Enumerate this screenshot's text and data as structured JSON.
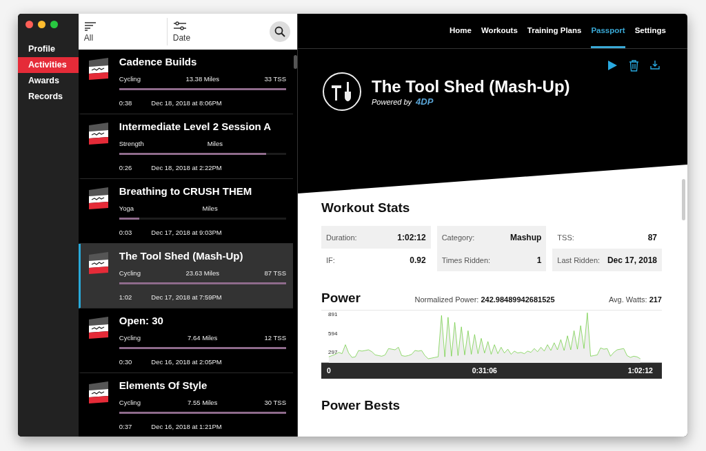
{
  "window": {
    "controls": [
      {
        "color": "#fe5f57"
      },
      {
        "color": "#febc2e"
      },
      {
        "color": "#28c840"
      }
    ]
  },
  "sidebar": {
    "items": [
      {
        "label": "Profile",
        "selected": false
      },
      {
        "label": "Activities",
        "selected": true
      },
      {
        "label": "Awards",
        "selected": false
      },
      {
        "label": "Records",
        "selected": false
      }
    ]
  },
  "toolbar": {
    "filter": "All",
    "sort": "Date"
  },
  "activities": [
    {
      "title": "Cadence Builds",
      "type": "Cycling",
      "distance": "13.38 Miles",
      "tss": "33 TSS",
      "duration": "0:38",
      "date": "Dec 18, 2018 at 8:06PM",
      "level": 1,
      "selected": false
    },
    {
      "title": "Intermediate Level 2 Session A",
      "type": "Strength",
      "distance": "Miles",
      "duration": "0:26",
      "date": "Dec 18, 2018 at 2:22PM",
      "level": 0.88,
      "selected": false
    },
    {
      "title": "Breathing to CRUSH THEM",
      "type": "Yoga",
      "distance": "Miles",
      "duration": "0:03",
      "date": "Dec 17, 2018 at 9:03PM",
      "level": 0.12,
      "selected": false
    },
    {
      "title": "The Tool Shed (Mash-Up)",
      "type": "Cycling",
      "distance": "23.63 Miles",
      "tss": "87 TSS",
      "duration": "1:02",
      "date": "Dec 17, 2018 at 7:59PM",
      "level": 1,
      "selected": true
    },
    {
      "title": "Open: 30",
      "type": "Cycling",
      "distance": "7.64 Miles",
      "tss": "12 TSS",
      "duration": "0:30",
      "date": "Dec 16, 2018 at 2:05PM",
      "level": 1,
      "selected": false
    },
    {
      "title": "Elements Of Style",
      "type": "Cycling",
      "distance": "7.55 Miles",
      "tss": "30 TSS",
      "duration": "0:37",
      "date": "Dec 16, 2018 at 1:21PM",
      "level": 1,
      "selected": false
    }
  ],
  "nav": [
    {
      "label": "Home",
      "selected": false
    },
    {
      "label": "Workouts",
      "selected": false
    },
    {
      "label": "Training Plans",
      "selected": false
    },
    {
      "label": "Passport",
      "selected": true
    },
    {
      "label": "Settings",
      "selected": false
    }
  ],
  "workout": {
    "title": "The Tool Shed (Mash-Up)",
    "powered_by": "Powered by",
    "brand": "4DP"
  },
  "stats": {
    "title": "Workout Stats",
    "items": [
      {
        "label": "Duration:",
        "value": "1:02:12"
      },
      {
        "label": "Category:",
        "value": "Mashup"
      },
      {
        "label": "TSS:",
        "value": "87"
      },
      {
        "label": "IF:",
        "value": "0.92"
      },
      {
        "label": "Times Ridden:",
        "value": "1"
      },
      {
        "label": "Last Ridden:",
        "value": "Dec 17, 2018"
      }
    ]
  },
  "power": {
    "title": "Power",
    "normalized_label": "Normalized Power:",
    "normalized_value": "242.98489942681525",
    "avg_label": "Avg. Watts:",
    "avg_value": "217",
    "chart_data": {
      "type": "area",
      "xlim": [
        -90,
        3990
      ],
      "ylim": [
        135,
        967
      ],
      "yticks": [
        297,
        594,
        891
      ],
      "xticks": [
        {
          "value": 0,
          "label": "0"
        },
        {
          "value": 1866,
          "label": "0:31:06"
        },
        {
          "value": 3732,
          "label": "1:02:12"
        }
      ],
      "x": [
        0,
        40,
        79,
        119,
        159,
        199,
        238,
        278,
        318,
        357,
        397,
        437,
        476,
        516,
        556,
        596,
        635,
        675,
        715,
        754,
        794,
        834,
        873,
        913,
        953,
        993,
        1032,
        1072,
        1112,
        1151,
        1191,
        1231,
        1270,
        1310,
        1350,
        1390,
        1429,
        1469,
        1509,
        1548,
        1588,
        1628,
        1668,
        1707,
        1747,
        1787,
        1826,
        1866,
        1906,
        1945,
        1985,
        2025,
        2064,
        2104,
        2144,
        2184,
        2223,
        2263,
        2303,
        2342,
        2382,
        2422,
        2461,
        2501,
        2541,
        2581,
        2620,
        2660,
        2700,
        2739,
        2779,
        2819,
        2859,
        2898,
        2938,
        2978,
        3017,
        3057,
        3097,
        3136,
        3176,
        3216,
        3256,
        3295,
        3335,
        3375,
        3414,
        3454,
        3494,
        3533,
        3573,
        3613,
        3652,
        3692,
        3732
      ],
      "series": [
        {
          "color": "#66cc33",
          "values": [
            230,
            250,
            270,
            300,
            280,
            420,
            290,
            220,
            230,
            330,
            320,
            330,
            340,
            310,
            260,
            250,
            240,
            260,
            360,
            350,
            340,
            380,
            250,
            240,
            250,
            270,
            330,
            320,
            330,
            250,
            200,
            210,
            220,
            230,
            880,
            230,
            850,
            240,
            770,
            250,
            700,
            260,
            640,
            270,
            580,
            280,
            520,
            290,
            470,
            270,
            420,
            280,
            380,
            290,
            350,
            270,
            320,
            290,
            300,
            280,
            320,
            300,
            360,
            310,
            380,
            320,
            420,
            330,
            450,
            340,
            500,
            330,
            560,
            340,
            640,
            350,
            720,
            360,
            920,
            240,
            250,
            260,
            370,
            350,
            360,
            240,
            300,
            340,
            350,
            360,
            250,
            220,
            240,
            230,
            200
          ]
        }
      ]
    }
  },
  "power_bests": {
    "title": "Power Bests"
  }
}
